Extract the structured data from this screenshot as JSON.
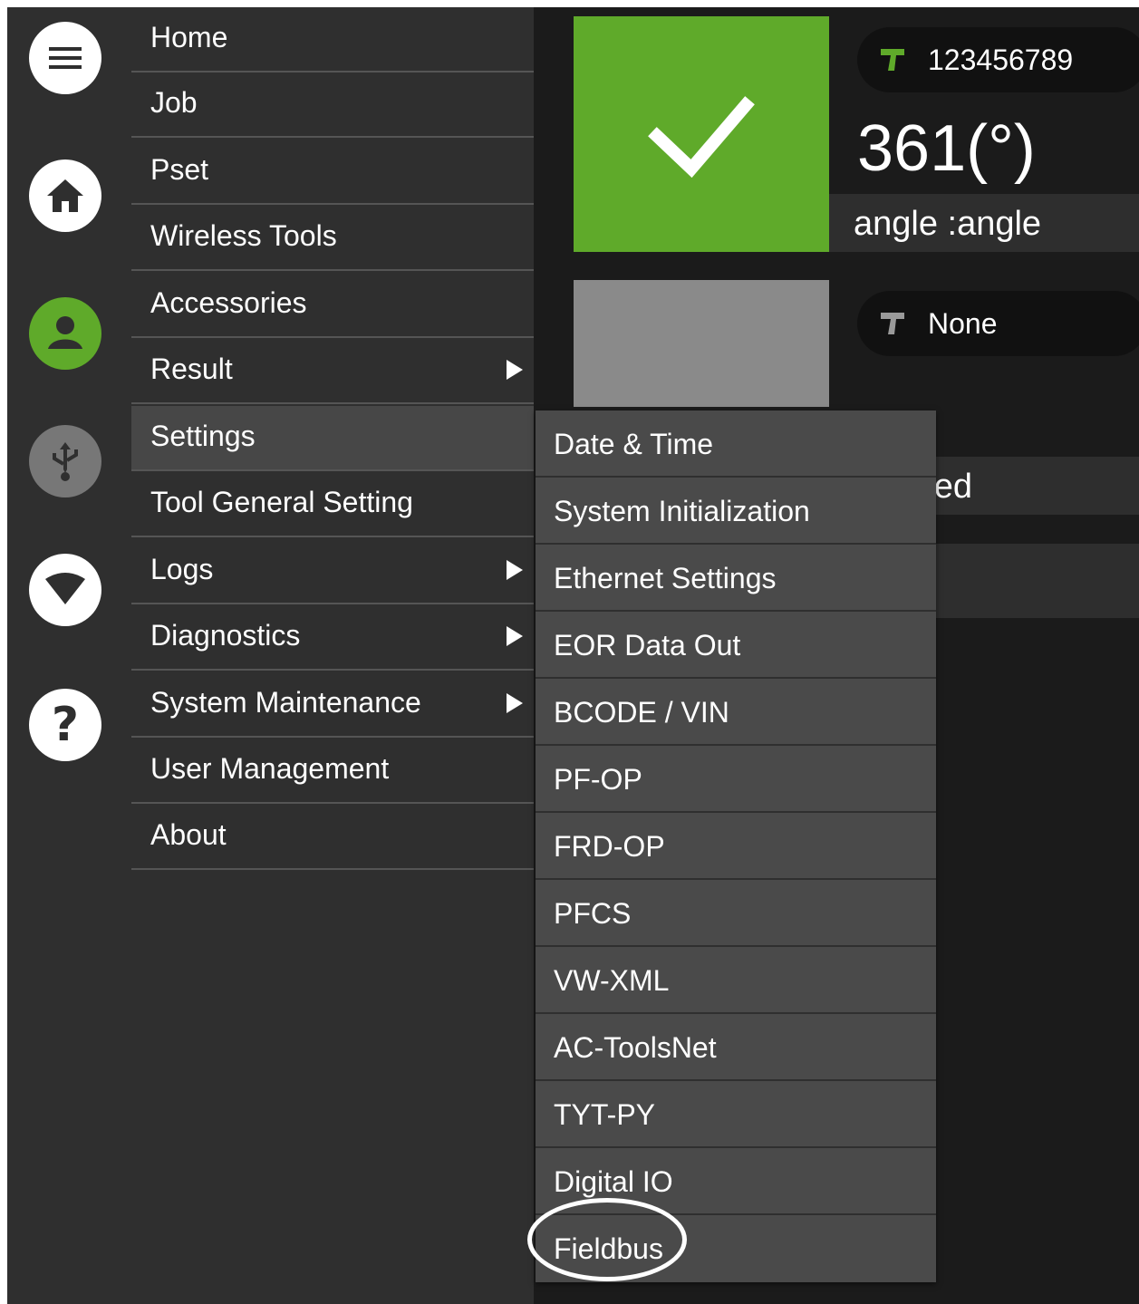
{
  "menu": {
    "items": [
      {
        "label": "Home",
        "has_submenu": false
      },
      {
        "label": "Job",
        "has_submenu": false
      },
      {
        "label": "Pset",
        "has_submenu": false
      },
      {
        "label": "Wireless Tools",
        "has_submenu": false
      },
      {
        "label": "Accessories",
        "has_submenu": false
      },
      {
        "label": "Result",
        "has_submenu": true
      },
      {
        "label": "Settings",
        "has_submenu": false,
        "selected": true
      },
      {
        "label": "Tool General Setting",
        "has_submenu": false
      },
      {
        "label": "Logs",
        "has_submenu": true
      },
      {
        "label": "Diagnostics",
        "has_submenu": true
      },
      {
        "label": "System Maintenance",
        "has_submenu": true
      },
      {
        "label": "User Management",
        "has_submenu": false
      },
      {
        "label": "About",
        "has_submenu": false
      }
    ]
  },
  "settings_submenu": {
    "items": [
      {
        "label": "Date & Time"
      },
      {
        "label": "System Initialization"
      },
      {
        "label": "Ethernet Settings"
      },
      {
        "label": "EOR Data Out"
      },
      {
        "label": "BCODE / VIN"
      },
      {
        "label": "PF-OP"
      },
      {
        "label": "FRD-OP"
      },
      {
        "label": "PFCS"
      },
      {
        "label": "VW-XML"
      },
      {
        "label": "AC-ToolsNet"
      },
      {
        "label": "TYT-PY"
      },
      {
        "label": "Digital IO"
      },
      {
        "label": "Fieldbus",
        "highlighted": true
      }
    ]
  },
  "rail": {
    "icons": [
      "menu-icon",
      "home-icon",
      "user-icon",
      "usb-icon",
      "wifi-icon",
      "help-icon"
    ],
    "user_icon_color": "#5faa2a",
    "usb_icon_color": "#777777"
  },
  "tools": [
    {
      "serial": "123456789",
      "value": "361(°)",
      "label": "angle :angle",
      "status_color": "#5faa2a",
      "tool_icon_color": "#5faa2a"
    },
    {
      "serial": "None",
      "label": "ssigned",
      "status_color": "#8a8a8a",
      "tool_icon_color": "#9a9a9a"
    }
  ]
}
